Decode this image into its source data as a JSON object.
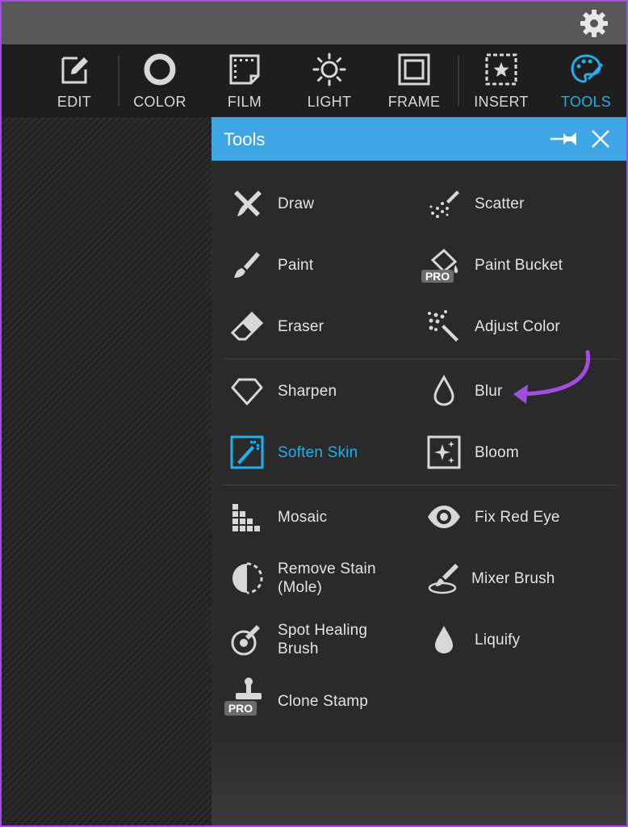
{
  "toolbar": {
    "items": [
      {
        "label": "EDIT",
        "icon": "edit-icon"
      },
      {
        "label": "COLOR",
        "icon": "color-icon"
      },
      {
        "label": "FILM",
        "icon": "film-icon"
      },
      {
        "label": "LIGHT",
        "icon": "light-icon"
      },
      {
        "label": "FRAME",
        "icon": "frame-icon"
      },
      {
        "label": "INSERT",
        "icon": "insert-icon"
      },
      {
        "label": "TOOLS",
        "icon": "tools-icon",
        "active": true
      }
    ]
  },
  "panel": {
    "title": "Tools",
    "tools": {
      "draw": "Draw",
      "scatter": "Scatter",
      "paint": "Paint",
      "paint_bucket": "Paint Bucket",
      "eraser": "Eraser",
      "adjust_color": "Adjust Color",
      "sharpen": "Sharpen",
      "blur": "Blur",
      "soften_skin": "Soften Skin",
      "bloom": "Bloom",
      "mosaic": "Mosaic",
      "fix_red_eye": "Fix Red Eye",
      "remove_stain_1": "Remove Stain",
      "remove_stain_2": "(Mole)",
      "mixer_brush": "Mixer Brush",
      "spot_healing_1": "Spot Healing",
      "spot_healing_2": "Brush",
      "liquify": "Liquify",
      "clone_stamp": "Clone Stamp"
    },
    "pro_badge": "PRO"
  },
  "colors": {
    "accent": "#1fb0ee",
    "header": "#3fa6e6",
    "annotation_arrow": "#a34ce0"
  }
}
